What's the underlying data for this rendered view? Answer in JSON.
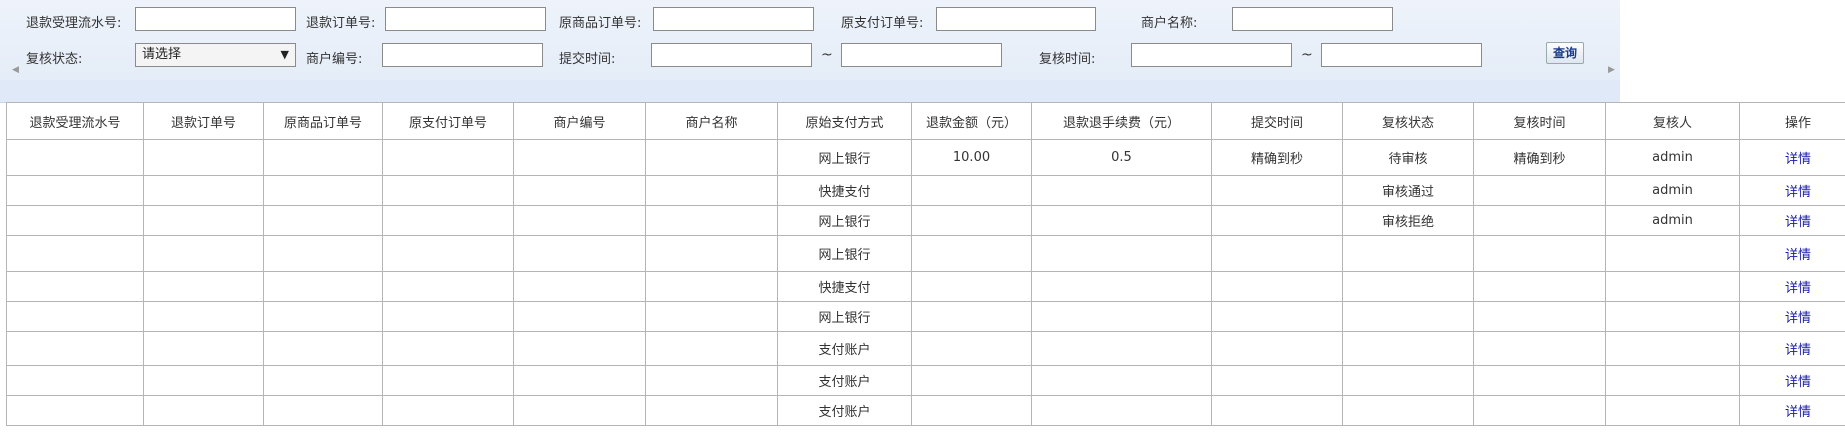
{
  "filters": {
    "refund_serial_label": "退款受理流水号:",
    "refund_order_label": "退款订单号:",
    "orig_goods_order_label": "原商品订单号:",
    "orig_pay_order_label": "原支付订单号:",
    "merchant_name_label": "商户名称:",
    "review_status_label": "复核状态:",
    "review_status_value": "请选择",
    "merchant_no_label": "商户编号:",
    "submit_time_label": "提交时间:",
    "review_time_label": "复核时间:",
    "range_sep": "~",
    "query_button": "查询"
  },
  "table": {
    "headers": [
      "退款受理流水号",
      "退款订单号",
      "原商品订单号",
      "原支付订单号",
      "商户编号",
      "商户名称",
      "原始支付方式",
      "退款金额（元）",
      "退款退手续费（元）",
      "提交时间",
      "复核状态",
      "复核时间",
      "复核人",
      "操作"
    ],
    "rows": [
      [
        "",
        "",
        "",
        "",
        "",
        "",
        "网上银行",
        "10.00",
        "0.5",
        "精确到秒",
        "待审核",
        "精确到秒",
        "admin",
        "详情"
      ],
      [
        "",
        "",
        "",
        "",
        "",
        "",
        "快捷支付",
        "",
        "",
        "",
        "审核通过",
        "",
        "admin",
        "详情"
      ],
      [
        "",
        "",
        "",
        "",
        "",
        "",
        "网上银行",
        "",
        "",
        "",
        "审核拒绝",
        "",
        "admin",
        "详情"
      ],
      [
        "",
        "",
        "",
        "",
        "",
        "",
        "网上银行",
        "",
        "",
        "",
        "",
        "",
        "",
        "详情"
      ],
      [
        "",
        "",
        "",
        "",
        "",
        "",
        "快捷支付",
        "",
        "",
        "",
        "",
        "",
        "",
        "详情"
      ],
      [
        "",
        "",
        "",
        "",
        "",
        "",
        "网上银行",
        "",
        "",
        "",
        "",
        "",
        "",
        "详情"
      ],
      [
        "",
        "",
        "",
        "",
        "",
        "",
        "支付账户",
        "",
        "",
        "",
        "",
        "",
        "",
        "详情"
      ],
      [
        "",
        "",
        "",
        "",
        "",
        "",
        "支付账户",
        "",
        "",
        "",
        "",
        "",
        "",
        "详情"
      ],
      [
        "",
        "",
        "",
        "",
        "",
        "",
        "支付账户",
        "",
        "",
        "",
        "",
        "",
        "",
        "详情"
      ]
    ]
  }
}
